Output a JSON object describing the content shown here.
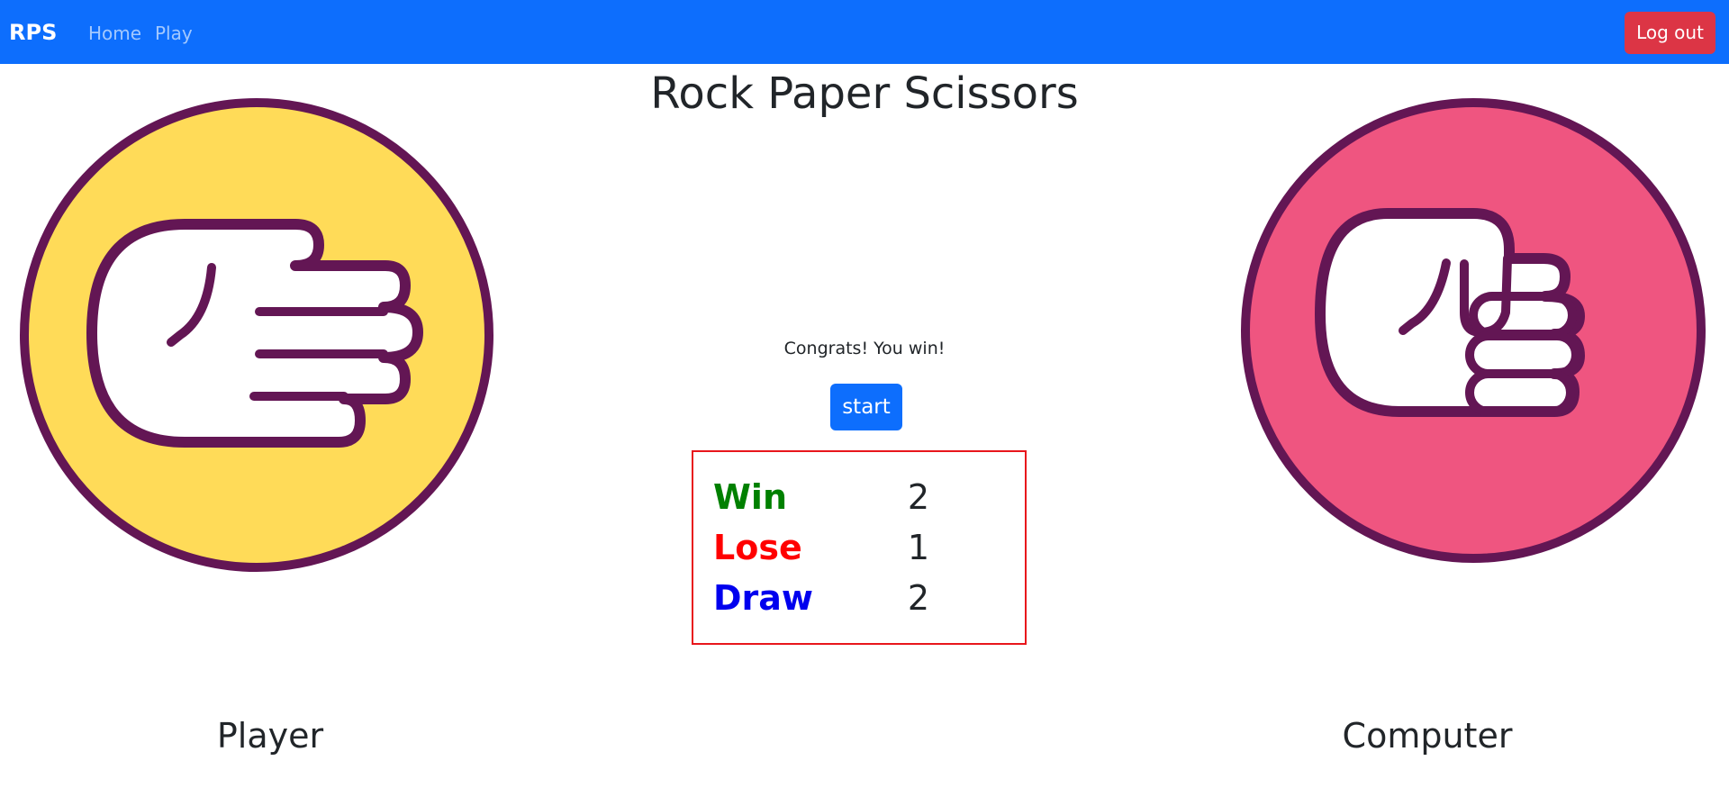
{
  "navbar": {
    "brand": "RPS",
    "links": [
      "Home",
      "Play"
    ],
    "logout_label": "Log out",
    "color": "#0d6efd"
  },
  "title": "Rock Paper Scissors",
  "player": {
    "label": "Player",
    "choice": "paper",
    "circle_color": "#ffdb58"
  },
  "computer": {
    "label": "Computer",
    "choice": "rock",
    "circle_color": "#ef5580"
  },
  "game": {
    "message": "Congrats! You win!",
    "start_label": "start"
  },
  "score": {
    "win_label": "Win",
    "win_value": "2",
    "win_color": "#008000",
    "lose_label": "Lose",
    "lose_value": "1",
    "lose_color": "#ff0000",
    "draw_label": "Draw",
    "draw_value": "2",
    "draw_color": "#0000ee"
  }
}
